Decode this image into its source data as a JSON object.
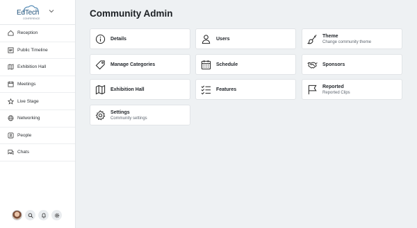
{
  "brand": {
    "logo_text": "EdTech",
    "logo_sub": "CONFERENCE"
  },
  "sidebar": {
    "items": [
      {
        "label": "Reception",
        "icon": "home-icon"
      },
      {
        "label": "Public Timeline",
        "icon": "timeline-icon"
      },
      {
        "label": "Exhibition Hall",
        "icon": "map-icon"
      },
      {
        "label": "Meetings",
        "icon": "calendar-icon"
      },
      {
        "label": "Live Stage",
        "icon": "star-icon"
      },
      {
        "label": "Networking",
        "icon": "globe-icon"
      },
      {
        "label": "People",
        "icon": "person-icon"
      },
      {
        "label": "Chats",
        "icon": "chat-icon"
      }
    ]
  },
  "main": {
    "title": "Community Admin",
    "cards": [
      {
        "title": "Details",
        "subtitle": "",
        "icon": "info-icon"
      },
      {
        "title": "Users",
        "subtitle": "",
        "icon": "user-icon"
      },
      {
        "title": "Theme",
        "subtitle": "Change community theme",
        "icon": "paintbrush-icon"
      },
      {
        "title": "Manage Categories",
        "subtitle": "",
        "icon": "tag-icon"
      },
      {
        "title": "Schedule",
        "subtitle": "",
        "icon": "calendar-icon"
      },
      {
        "title": "Sponsors",
        "subtitle": "",
        "icon": "handshake-icon"
      },
      {
        "title": "Exhibition Hall",
        "subtitle": "",
        "icon": "map-icon"
      },
      {
        "title": "Features",
        "subtitle": "",
        "icon": "checklist-icon"
      },
      {
        "title": "Reported",
        "subtitle": "Reported Clips",
        "icon": "flag-icon"
      },
      {
        "title": "Settings",
        "subtitle": "Community settings",
        "icon": "gear-icon"
      }
    ]
  },
  "colors": {
    "background": "#eef1f3",
    "card": "#ffffff",
    "brand": "#20527a"
  }
}
